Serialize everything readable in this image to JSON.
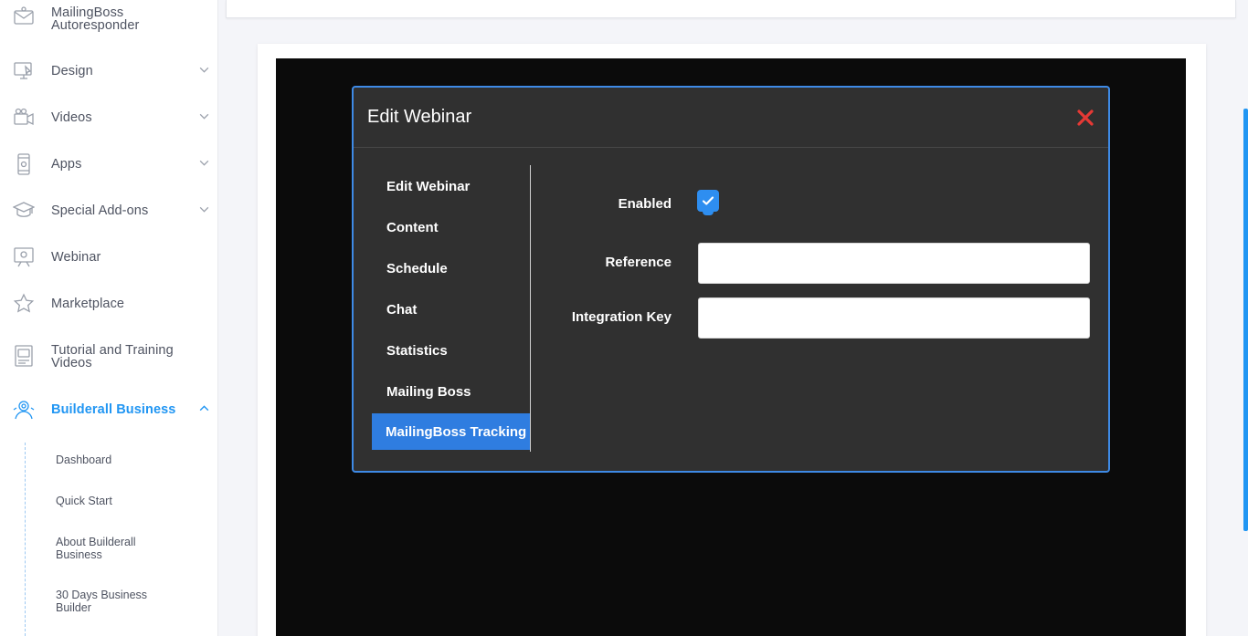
{
  "sidebar": {
    "items": [
      {
        "label": "MailingBoss Autoresponder",
        "icon": "mail-icon",
        "has_chevron": false
      },
      {
        "label": "Design",
        "icon": "design-icon",
        "has_chevron": true
      },
      {
        "label": "Videos",
        "icon": "video-camera-icon",
        "has_chevron": true
      },
      {
        "label": "Apps",
        "icon": "mobile-app-icon",
        "has_chevron": true
      },
      {
        "label": "Special Add-ons",
        "icon": "graduation-cap-icon",
        "has_chevron": true
      },
      {
        "label": "Webinar",
        "icon": "webinar-board-icon",
        "has_chevron": false
      },
      {
        "label": "Marketplace",
        "icon": "star-icon",
        "has_chevron": false
      },
      {
        "label": "Tutorial and Training Videos",
        "icon": "tutorial-icon",
        "has_chevron": false
      },
      {
        "label": "Builderall Business",
        "icon": "business-icon",
        "has_chevron": true,
        "active": true
      }
    ],
    "sub_items": [
      {
        "label": "Dashboard"
      },
      {
        "label": "Quick Start"
      },
      {
        "label": "About Builderall Business"
      },
      {
        "label": "30 Days Business Builder"
      }
    ]
  },
  "modal": {
    "title": "Edit Webinar",
    "menu": [
      {
        "label": "Edit Webinar"
      },
      {
        "label": "Content"
      },
      {
        "label": "Schedule"
      },
      {
        "label": "Chat"
      },
      {
        "label": "Statistics"
      },
      {
        "label": "Mailing Boss"
      },
      {
        "label": "MailingBoss Tracking",
        "active": true
      }
    ],
    "form": {
      "enabled_label": "Enabled",
      "enabled_checked": true,
      "reference_label": "Reference",
      "reference_value": "",
      "integration_key_label": "Integration Key",
      "integration_key_value": ""
    }
  },
  "colors": {
    "accent": "#2196f3",
    "modal_bg": "#303030",
    "active_menu": "#2f7de0",
    "close": "#e53935",
    "panel_bg": "#0b0b0b"
  }
}
